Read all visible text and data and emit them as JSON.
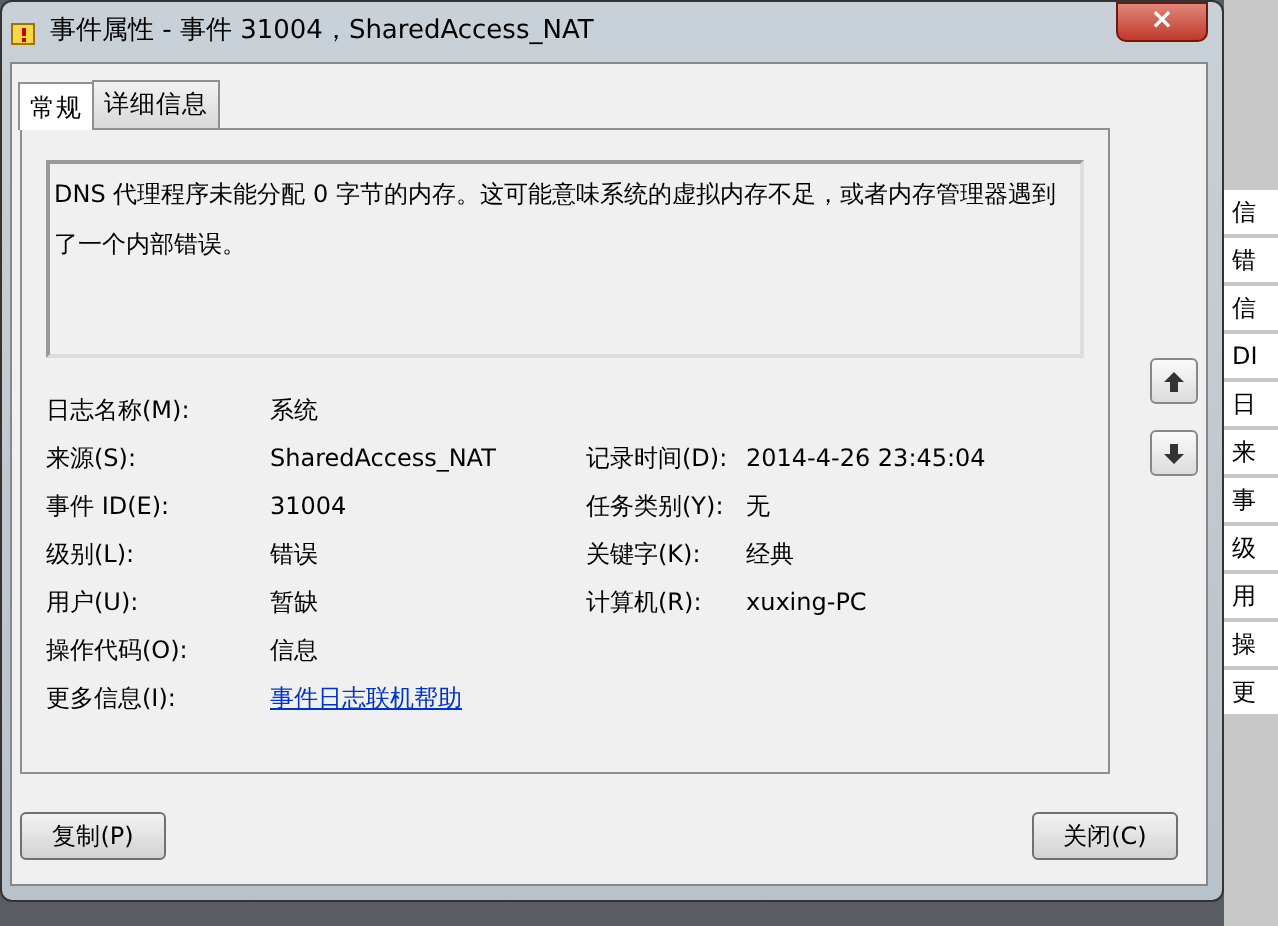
{
  "window": {
    "title": "事件属性 - 事件 31004，SharedAccess_NAT",
    "close": "×"
  },
  "tabs": [
    {
      "label": "常规",
      "selected": true
    },
    {
      "label": "详细信息",
      "selected": false
    }
  ],
  "message": "DNS 代理程序未能分配 0 字节的内存。这可能意味系统的虚拟内存不足，或者内存管理器遇到了一个内部错误。",
  "fields": [
    [
      {
        "label": "日志名称(M):",
        "value": "系统"
      }
    ],
    [
      {
        "label": "来源(S):",
        "value": "SharedAccess_NAT"
      },
      {
        "label": "记录时间(D):",
        "value": "2014-4-26 23:45:04"
      }
    ],
    [
      {
        "label": "事件 ID(E):",
        "value": "31004"
      },
      {
        "label": "任务类别(Y):",
        "value": "无"
      }
    ],
    [
      {
        "label": "级别(L):",
        "value": "错误"
      },
      {
        "label": "关键字(K):",
        "value": "经典"
      }
    ],
    [
      {
        "label": "用户(U):",
        "value": "暂缺"
      },
      {
        "label": "计算机(R):",
        "value": "xuxing-PC"
      }
    ],
    [
      {
        "label": "操作代码(O):",
        "value": "信息"
      }
    ],
    [
      {
        "label": "更多信息(I):",
        "value": "事件日志联机帮助",
        "kind": "link"
      }
    ]
  ],
  "buttons": [
    {
      "label": "复制(P)"
    },
    {
      "label": "关闭(C)"
    }
  ],
  "background_window": [
    "信",
    "错",
    "信",
    "DI",
    "日",
    "来",
    "事",
    "级",
    "用",
    "操",
    "更"
  ]
}
